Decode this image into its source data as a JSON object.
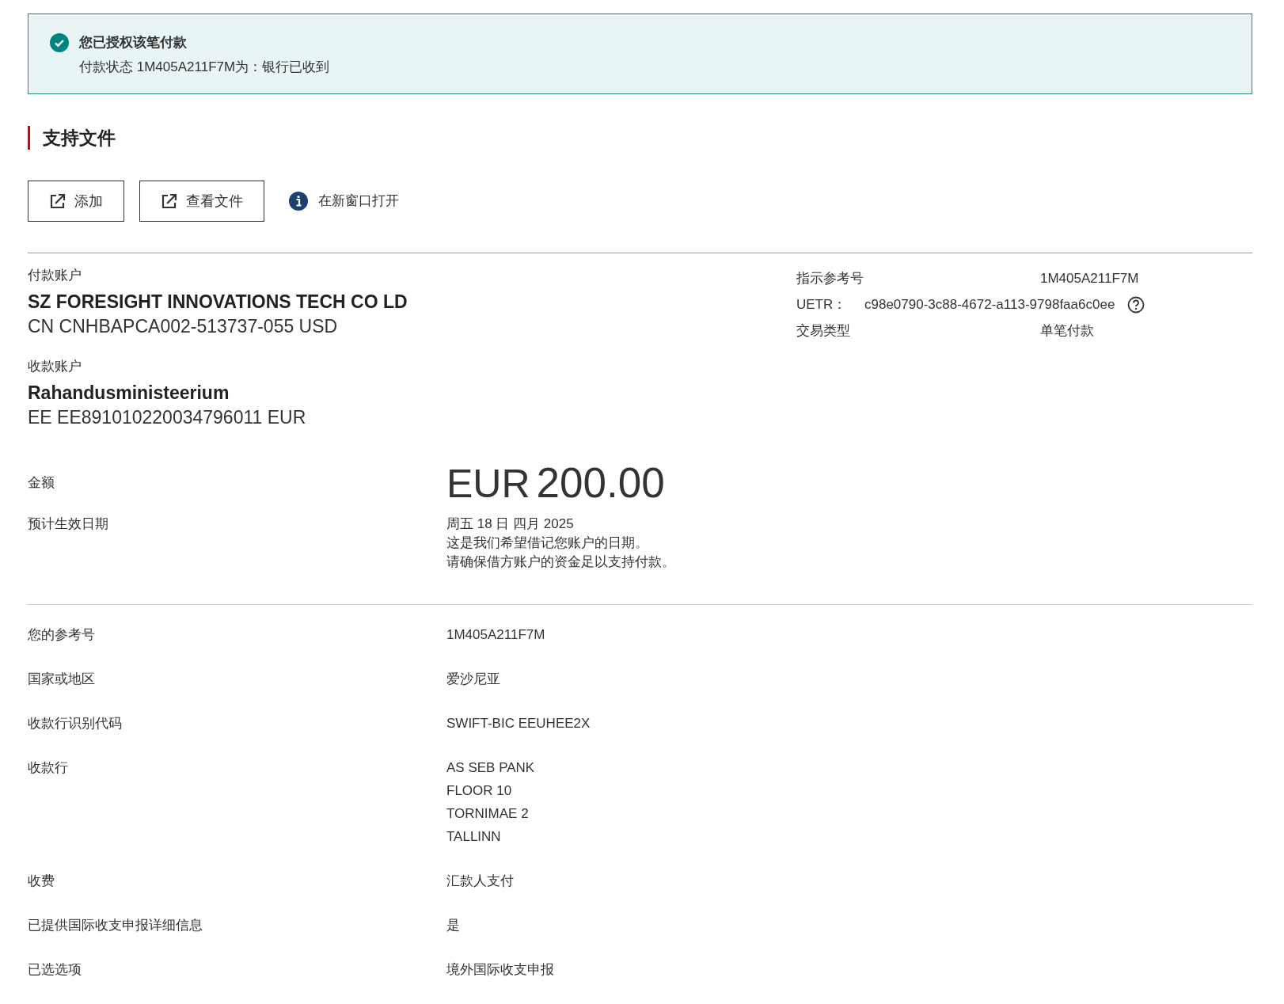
{
  "banner": {
    "title": "您已授权该笔付款",
    "message": "付款状态 1M405A211F7M为：银行已收到"
  },
  "section_title": "支持文件",
  "buttons": [
    {
      "label": "添加"
    },
    {
      "label": "查看文件"
    }
  ],
  "info_note": "在新窗口打开",
  "payer": {
    "label": "付款账户",
    "name": "SZ FORESIGHT INNOVATIONS TECH CO LD",
    "account": "CN CNHBAPCA002-513737-055 USD"
  },
  "payee": {
    "label": "收款账户",
    "name": "Rahandusministeerium",
    "account": "EE EE891010220034796011 EUR"
  },
  "reference_info": [
    {
      "kind": "plain",
      "label": "指示参考号",
      "value": "1M405A211F7M"
    },
    {
      "kind": "help",
      "label": "UETR：",
      "value": "c98e0790-3c88-4672-a113-9798faa6c0ee"
    },
    {
      "kind": "plain",
      "label": "交易类型",
      "value": "单笔付款"
    }
  ],
  "amount": {
    "label": "金额",
    "currency": "EUR",
    "value": "200.00"
  },
  "effective_date": {
    "label": "预计生效日期",
    "date": "周五 18 日 四月 2025",
    "notes": [
      "这是我们希望借记您账户的日期。",
      "请确保借方账户的资金足以支持付款。"
    ]
  },
  "details": [
    {
      "label": "您的参考号",
      "lines": [
        "1M405A211F7M"
      ]
    },
    {
      "label": "国家或地区",
      "lines": [
        "爱沙尼亚"
      ]
    },
    {
      "label": "收款行识别代码",
      "lines": [
        "SWIFT-BIC EEUHEE2X"
      ]
    },
    {
      "label": "收款行",
      "lines": [
        "AS SEB PANK",
        "FLOOR 10",
        "TORNIMAE 2",
        "TALLINN"
      ]
    },
    {
      "label": "收费",
      "lines": [
        "汇款人支付"
      ]
    },
    {
      "label": "已提供国际收支申报详细信息",
      "lines": [
        "是"
      ]
    },
    {
      "label": "已选选项",
      "lines": [
        "境外国际收支申报"
      ]
    }
  ]
}
